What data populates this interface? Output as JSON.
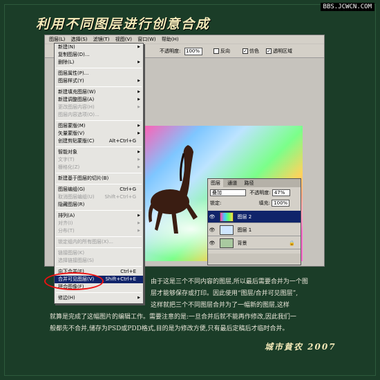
{
  "watermark": "BBS.JCWCN.COM",
  "title": "利用不同图层进行创意合成",
  "menubar": [
    "图层(L)",
    "选择(S)",
    "滤镜(T)",
    "视图(V)",
    "窗口(W)",
    "帮助(H)"
  ],
  "options": {
    "opacity_label": "不透明度:",
    "opacity_value": "100%",
    "reverse": "反向",
    "dither": "仿色",
    "transparency": "透明区域"
  },
  "menu": {
    "items": [
      {
        "label": "新建(N)",
        "arrow": true
      },
      {
        "label": "复制图层(D)..."
      },
      {
        "label": "删除(L)",
        "arrow": true
      },
      {
        "sep": true
      },
      {
        "label": "图层属性(P)..."
      },
      {
        "label": "图层样式(Y)",
        "arrow": true
      },
      {
        "sep": true
      },
      {
        "label": "新建填充图层(W)",
        "arrow": true
      },
      {
        "label": "新建调整图层(A)",
        "arrow": true
      },
      {
        "label": "更改图层内容(H)",
        "arrow": true,
        "disabled": true
      },
      {
        "label": "图层内容选项(O)...",
        "disabled": true
      },
      {
        "sep": true
      },
      {
        "label": "图层蒙版(M)",
        "arrow": true
      },
      {
        "label": "矢量蒙版(V)",
        "arrow": true
      },
      {
        "label": "创建剪贴蒙版(C)",
        "shortcut": "Alt+Ctrl+G"
      },
      {
        "sep": true
      },
      {
        "label": "智能对象",
        "arrow": true
      },
      {
        "label": "文字(T)",
        "arrow": true,
        "disabled": true
      },
      {
        "label": "栅格化(Z)",
        "arrow": true,
        "disabled": true
      },
      {
        "sep": true
      },
      {
        "label": "新建基于图层的切片(B)"
      },
      {
        "sep": true
      },
      {
        "label": "图层编组(G)",
        "shortcut": "Ctrl+G"
      },
      {
        "label": "取消图层编组(U)",
        "shortcut": "Shift+Ctrl+G",
        "disabled": true
      },
      {
        "label": "隐藏图层(R)"
      },
      {
        "sep": true
      },
      {
        "label": "排列(A)",
        "arrow": true
      },
      {
        "label": "对齐(I)",
        "arrow": true,
        "disabled": true
      },
      {
        "label": "分布(T)",
        "arrow": true,
        "disabled": true
      },
      {
        "sep": true
      },
      {
        "label": "锁定组内的所有图层(X)...",
        "disabled": true
      },
      {
        "sep": true
      },
      {
        "label": "链接图层(K)",
        "disabled": true
      },
      {
        "label": "选择链接图层(S)",
        "disabled": true
      },
      {
        "sep": true
      },
      {
        "label": "向下合并(E)",
        "shortcut": "Ctrl+E"
      },
      {
        "label": "合并可见图层(V)",
        "shortcut": "Shift+Ctrl+E",
        "highlighted": true
      },
      {
        "label": "拼合图像(F)"
      },
      {
        "sep": true
      },
      {
        "label": "修边(H)",
        "arrow": true
      }
    ]
  },
  "layers_panel": {
    "tabs": [
      "图层",
      "通道",
      "路径"
    ],
    "blend_mode": "叠加",
    "opacity_label": "不透明度:",
    "opacity_value": "47%",
    "lock_label": "锁定:",
    "fill_label": "填充:",
    "fill_value": "100%",
    "layers": [
      {
        "name": "图层 2",
        "selected": true
      },
      {
        "name": "图层 1"
      },
      {
        "name": "背景"
      }
    ]
  },
  "caption": {
    "line1": "由于这是三个不同内容的图层,所以最后需要合并为一个图",
    "line2": "层才能够保存或打印。因此使用“图层/合并可见图层”,",
    "line3": "这样就把三个不同图层合并为了一幅新的图层,这样",
    "line4": "就算是完成了这幅图片的编辑工作。需要注意的是:一旦合并后就不能再作修改,因此我们一",
    "line5": "般都先不合并,储存为PSD或PDD格式,目的是为修改方便,只有最后定稿后才临时合并。"
  },
  "signature": "城市貧农  2007",
  "colors": {
    "background": "#1b3d28",
    "title": "#f3e9b8",
    "menu_highlight": "#10246a",
    "circle": "#e11111"
  }
}
